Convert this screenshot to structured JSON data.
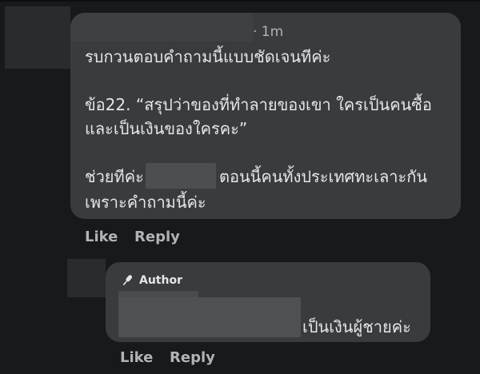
{
  "comment": {
    "time": "· 1m",
    "lines": [
      "รบกวนตอบคำถามนี้แบบชัดเจนทีค่ะ",
      "ข้อ22. “สรุปว่าของที่ทำลายของเขา ใครเป็นคนซื้อ",
      "และเป็นเงินของใครคะ”",
      "ช่วยทีค่ะ",
      "ตอนนี้คนทั้งประเทศทะเลาะกัน",
      "เพราะคำถามนี้ค่ะ"
    ],
    "actions": {
      "like": "Like",
      "reply": "Reply"
    }
  },
  "reply": {
    "badge": "Author",
    "text": "เป็นเงินผู้ชายค่ะ",
    "actions": {
      "like": "Like",
      "reply": "Reply"
    }
  },
  "icons": {
    "author_badge": "microphone-icon"
  },
  "colors": {
    "background": "#18191a",
    "bubble": "#3a3b3c",
    "text": "#e4e6eb",
    "muted": "#b0b3b8"
  }
}
